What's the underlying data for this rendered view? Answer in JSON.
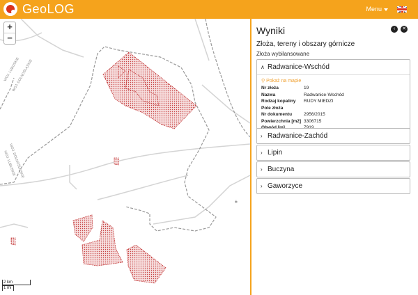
{
  "app": {
    "title": "GeoLOG"
  },
  "header": {
    "menu_label": "Menu",
    "language_icon": "uk-flag-icon"
  },
  "map": {
    "zoom_in": "+",
    "zoom_out": "−",
    "scale_km": "2 km",
    "scale_mi": "1 mi"
  },
  "panel": {
    "title": "Wyniki",
    "back_icon": "‹",
    "close_icon": "✕",
    "subtitle": "Złoża, tereny i obszary górnicze",
    "section_label": "Złoża wybilansowane",
    "deposits": [
      {
        "name": "Radwanice-Wschód",
        "expanded": true
      },
      {
        "name": "Radwanice-Zachód",
        "expanded": false
      },
      {
        "name": "Lipin",
        "expanded": false
      },
      {
        "name": "Buczyna",
        "expanded": false
      },
      {
        "name": "Gaworzyce",
        "expanded": false
      }
    ],
    "details": {
      "show_on_map": "Pokaż na mapie",
      "rows": [
        {
          "label": "Nr złoża",
          "value": "19"
        },
        {
          "label": "Nazwa",
          "value": "Radwanice-Wschód"
        },
        {
          "label": "Rodzaj kopaliny",
          "value": "RUDY MIEDZI"
        },
        {
          "label": "Pole złoża",
          "value": ""
        },
        {
          "label": "Nr dokumentu",
          "value": "2956/2015"
        },
        {
          "label": "Powierzchnia [m2]",
          "value": "3306715"
        },
        {
          "label": "Obwód [m]",
          "value": "7919"
        }
      ]
    }
  },
  "colors": {
    "accent": "#f5a31c",
    "deposit_fill": "#f2c4c4",
    "deposit_stroke": "#c03030"
  }
}
